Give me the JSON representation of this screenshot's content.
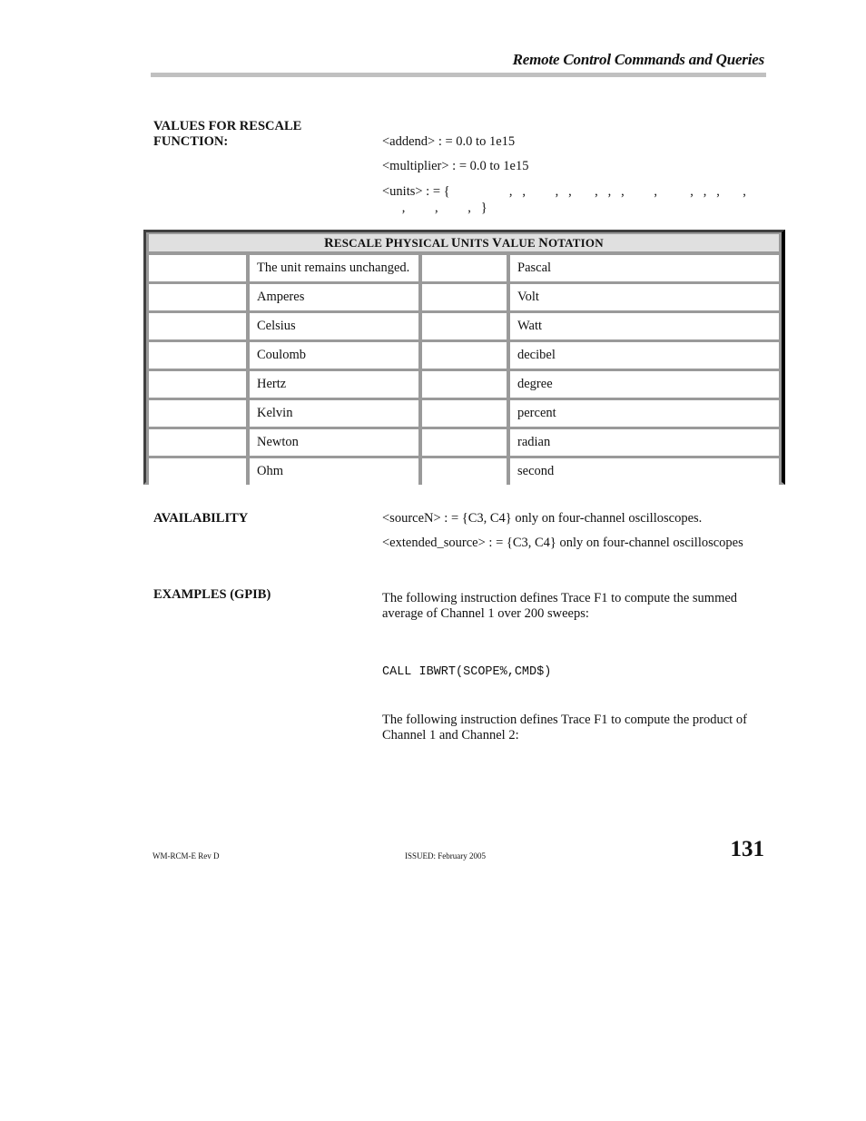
{
  "header": {
    "title": "Remote Control Commands and Queries"
  },
  "rescale_values": {
    "label_line1": "VALUES FOR RESCALE",
    "label_line2": "FUNCTION:",
    "addend": "<addend> : = 0.0 to 1e15",
    "multiplier": "<multiplier> : = 0.0 to 1e15",
    "units_line1": "<units> : = {                  ,   ,         ,   ,       ,   ,   ,         ,          ,   ,   ,       ,",
    "units_line2": "      ,         ,         ,   }"
  },
  "units_table": {
    "title_parts": [
      "R",
      "ESCALE ",
      "P",
      "HYSICAL ",
      "U",
      "NITS ",
      "V",
      "ALUE ",
      "N",
      "OTATION"
    ],
    "title": "Rescale Physical Units Value Notation",
    "rows": [
      {
        "code_left": "",
        "name_left": "The unit remains unchanged.",
        "code_right": "",
        "name_right": "Pascal"
      },
      {
        "code_left": "",
        "name_left": "Amperes",
        "code_right": "",
        "name_right": "Volt"
      },
      {
        "code_left": "",
        "name_left": "Celsius",
        "code_right": "",
        "name_right": "Watt"
      },
      {
        "code_left": "",
        "name_left": "Coulomb",
        "code_right": "",
        "name_right": "decibel"
      },
      {
        "code_left": "",
        "name_left": "Hertz",
        "code_right": "",
        "name_right": "degree"
      },
      {
        "code_left": "",
        "name_left": "Kelvin",
        "code_right": "",
        "name_right": "percent"
      },
      {
        "code_left": "",
        "name_left": "Newton",
        "code_right": "",
        "name_right": "radian"
      },
      {
        "code_left": "",
        "name_left": "Ohm",
        "code_right": "",
        "name_right": "second"
      }
    ]
  },
  "availability": {
    "label": "AVAILABILITY",
    "line1": "<sourceN> : = {C3, C4} only on four-channel oscilloscopes.",
    "line2": "<extended_source> : = {C3, C4} only on four-channel oscilloscopes"
  },
  "examples": {
    "label": "EXAMPLES (GPIB)",
    "example1_text": "The following instruction defines Trace F1 to compute the summed average of Channel 1 over 200 sweeps:",
    "code": "CALL IBWRT(SCOPE%,CMD$)",
    "example2_text": "The following instruction defines Trace F1 to compute the product of Channel 1 and Channel 2:"
  },
  "footer": {
    "doc_id": "WM-RCM-E Rev D",
    "issued": "ISSUED: February 2005",
    "page_number": "131"
  }
}
